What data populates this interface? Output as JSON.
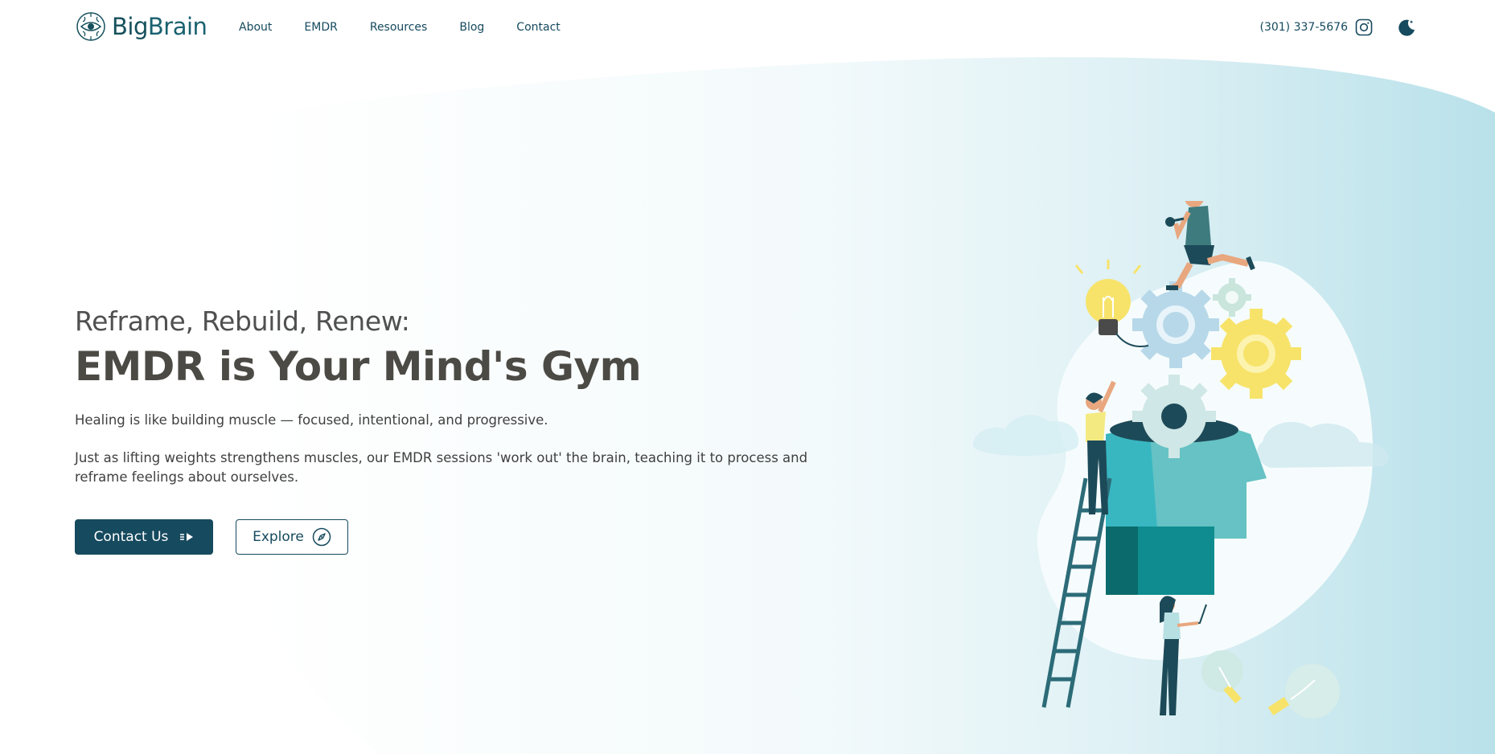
{
  "brand": {
    "name_light": "Big",
    "name_bold": "Brain",
    "icon": "brain-eye-logo-icon"
  },
  "nav": {
    "items": [
      "About",
      "EMDR",
      "Resources",
      "Blog",
      "Contact"
    ]
  },
  "header_tools": {
    "phone": "(301) 337-5676",
    "social_icon": "instagram-icon",
    "theme_icon": "moon-icon"
  },
  "hero": {
    "kicker": "Reframe, Rebuild, Renew:",
    "headline": "EMDR is Your Mind's Gym",
    "paragraph1": "Healing is like building muscle — focused, intentional, and progressive.",
    "paragraph2": "Just as lifting weights strengthens muscles, our EMDR sessions 'work out' the brain, teaching it to process and reframe feelings about ourselves.",
    "primary_button": "Contact Us",
    "primary_icon": "play-arrow-icon",
    "secondary_button": "Explore",
    "secondary_icon": "compass-icon"
  },
  "colors": {
    "brand": "#164a5e",
    "accent_teal": "#3bb5bf",
    "bg_wave": "#bfe4ec",
    "yellow": "#f7e36a"
  }
}
